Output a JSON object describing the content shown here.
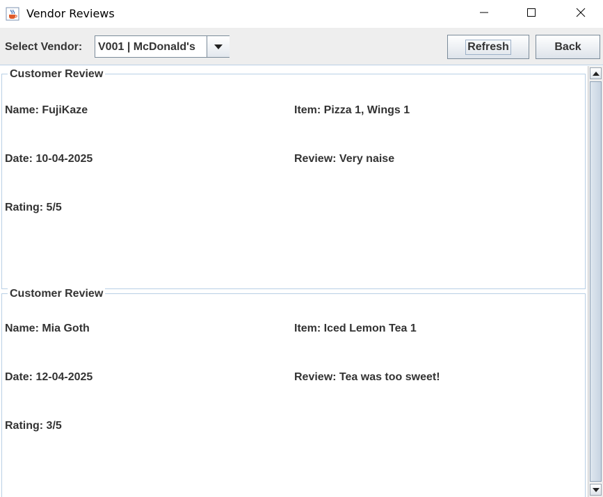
{
  "window": {
    "title": "Vendor Reviews",
    "icon": "java-coffee-cup-icon"
  },
  "toolbar": {
    "select_label": "Select Vendor:",
    "vendor_selected": "V001 | McDonald's",
    "refresh_label": "Refresh",
    "back_label": "Back"
  },
  "reviews": [
    {
      "legend": "Customer Review",
      "name": "Name: FujiKaze",
      "item": "Item: Pizza 1, Wings 1",
      "date": "Date: 10-04-2025",
      "review": "Review: Very naise",
      "rating": "Rating: 5/5"
    },
    {
      "legend": "Customer Review",
      "name": "Name: Mia Goth",
      "item": "Item: Iced Lemon Tea 1",
      "date": "Date: 12-04-2025",
      "review": "Review: Tea was too sweet!",
      "rating": "Rating: 3/5"
    }
  ],
  "colors": {
    "toolbar_bg": "#eeeeee",
    "border_accent": "#b8cfe5",
    "text": "#333333"
  }
}
